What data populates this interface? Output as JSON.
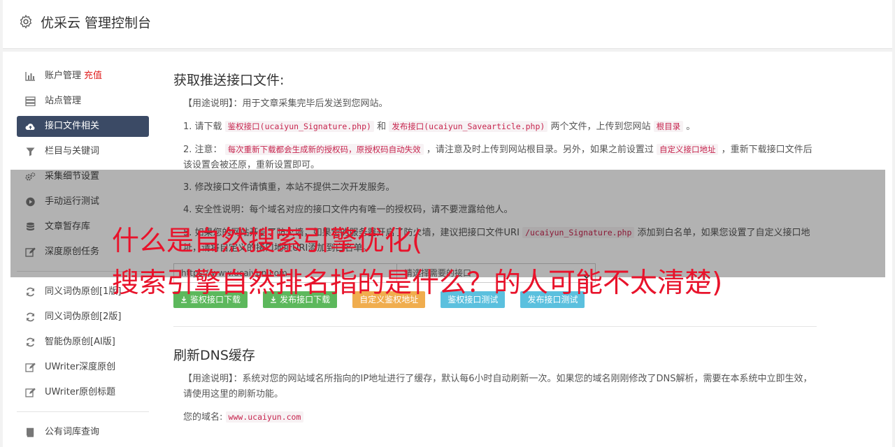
{
  "header": {
    "title": "优采云 管理控制台"
  },
  "sidebar": {
    "items": [
      {
        "label": "账户管理",
        "extra": "充值",
        "icon": "bar-chart-icon"
      },
      {
        "label": "站点管理",
        "icon": "server-icon"
      },
      {
        "label": "接口文件相关",
        "icon": "cloud-upload-icon",
        "active": true
      },
      {
        "label": "栏目与关键词",
        "icon": "filter-icon"
      },
      {
        "label": "采集细节设置",
        "icon": "gears-icon"
      },
      {
        "label": "手动运行测试",
        "icon": "play-circle-icon"
      },
      {
        "label": "文章暂存库",
        "icon": "database-icon"
      },
      {
        "label": "深度原创任务",
        "icon": "edit-icon"
      }
    ],
    "items2": [
      {
        "label": "同义词伪原创[1版]",
        "icon": "refresh-icon"
      },
      {
        "label": "同义词伪原创[2版]",
        "icon": "refresh-icon"
      },
      {
        "label": "智能伪原创[AI版]",
        "icon": "refresh-icon"
      },
      {
        "label": "UWriter深度原创",
        "icon": "edit-icon"
      },
      {
        "label": "UWriter原创标题",
        "icon": "edit-icon"
      }
    ],
    "items3": [
      {
        "label": "公有词库查询",
        "icon": "book-icon"
      }
    ]
  },
  "push": {
    "title": "获取推送接口文件:",
    "usage_label": "【用途说明】",
    "usage_text": "：用于文章采集完毕后发送到您网站。",
    "s1_a": "1. 请下载",
    "s1_code1": "鉴权接口(ucaiyun_Signature.php)",
    "s1_b": "和",
    "s1_code2": "发布接口(ucaiyun_Savearticle.php)",
    "s1_c": "两个文件，上传到您网站",
    "s1_code3": "根目录",
    "s1_d": "。",
    "s2_a": "2. 注意：",
    "s2_code1": "每次重新下载都会生成新的授权码，原授权码自动失效",
    "s2_b": "，请注意及时上传到网站根目录。另外，如果之前设置过",
    "s2_code2": "自定义接口地址",
    "s2_c": "，重新下载接口文件后该设置会被还原，重新设置即可。",
    "s3": "3. 修改接口文件请慎重，本站不提供二次开发服务。",
    "s4": "4. 安全性说明：每个域名对应的接口文件内有唯一的授权码，请不要泄露给他人。",
    "s5_a": "5. 如果您的网站开启了防火墙，如果您的服务器开启了防火墙，建议把接口文件URI",
    "s5_code1": "/ucaiyun_Signature.php",
    "s5_b": "添加到白名单，如果您设置了自定义接口地址，请将自定义的接口地址URI添加到白名单。",
    "url_value": "https://www.ucaiyun.com",
    "select_value": "请选择需要的接口",
    "btn_sign_download": "鉴权接口下载",
    "btn_publish_download": "发布接口下载",
    "btn_custom_sign": "自定义鉴权地址",
    "btn_sign_test": "鉴权接口测试",
    "btn_publish_test": "发布接口测试"
  },
  "dns": {
    "title": "刷新DNS缓存",
    "usage_label": "【用途说明】",
    "usage_text": "：系统对您的网站域名所指向的IP地址进行了缓存，默认每6小时自动刷新一次。如果您的域名刚刚修改了DNS解析，需要在本系统中立即生效，请使用这里的刷新功能。",
    "domain_label": "您的域名:",
    "domain_value": "www.ucaiyun.com"
  },
  "overlay": {
    "line1": "什么是自然搜索引擎优化(",
    "line2": "搜索引擎自然排名指的是什么？的人可能不太清楚)"
  }
}
